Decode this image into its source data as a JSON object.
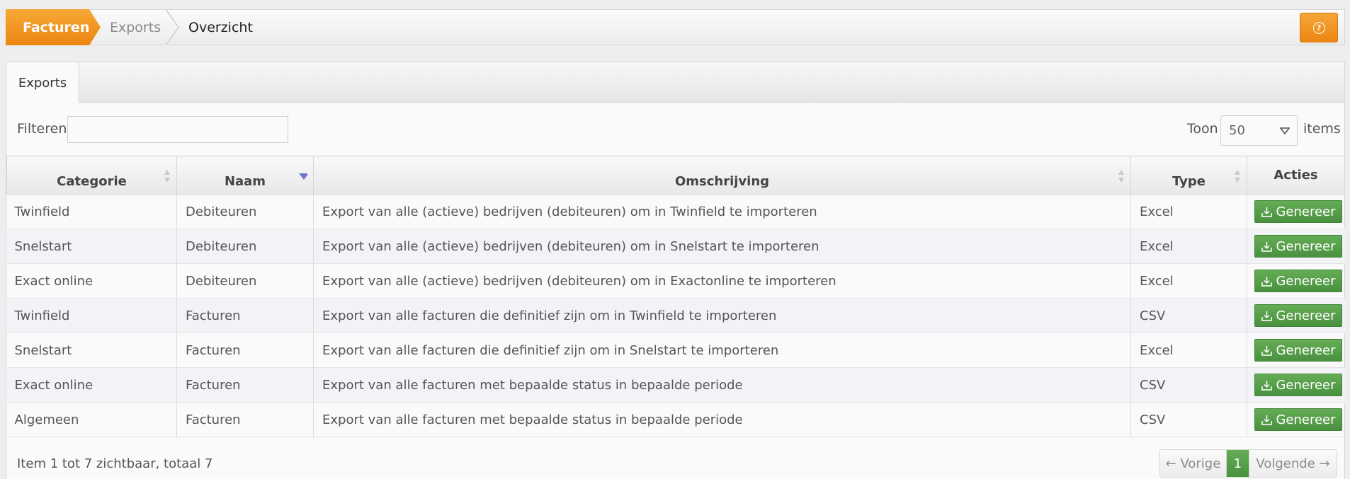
{
  "breadcrumb": {
    "home": "Facturen",
    "items": [
      "Exports",
      "Overzicht"
    ]
  },
  "help": {
    "icon": "help-icon",
    "glyph": "?"
  },
  "tabs": [
    {
      "label": "Exports"
    }
  ],
  "filter": {
    "label": "Filteren",
    "value": ""
  },
  "page_size": {
    "label_before": "Toon",
    "value": "50",
    "label_after": "items"
  },
  "table": {
    "columns": [
      "Categorie",
      "Naam",
      "Omschrijving",
      "Type",
      "Acties"
    ],
    "sorted_column": "Naam",
    "sort_direction": "descending",
    "action_label": "Genereer",
    "rows": [
      {
        "categorie": "Twinfield",
        "naam": "Debiteuren",
        "omschrijving": "Export van alle (actieve) bedrijven (debiteuren) om in Twinfield te importeren",
        "type": "Excel"
      },
      {
        "categorie": "Snelstart",
        "naam": "Debiteuren",
        "omschrijving": "Export van alle (actieve) bedrijven (debiteuren) om in Snelstart te importeren",
        "type": "Excel"
      },
      {
        "categorie": "Exact online",
        "naam": "Debiteuren",
        "omschrijving": "Export van alle (actieve) bedrijven (debiteuren) om in Exactonline te importeren",
        "type": "Excel"
      },
      {
        "categorie": "Twinfield",
        "naam": "Facturen",
        "omschrijving": "Export van alle facturen die definitief zijn om in Twinfield te importeren",
        "type": "CSV"
      },
      {
        "categorie": "Snelstart",
        "naam": "Facturen",
        "omschrijving": "Export van alle facturen die definitief zijn om in Snelstart te importeren",
        "type": "Excel"
      },
      {
        "categorie": "Exact online",
        "naam": "Facturen",
        "omschrijving": "Export van alle facturen met bepaalde status in bepaalde periode",
        "type": "CSV"
      },
      {
        "categorie": "Algemeen",
        "naam": "Facturen",
        "omschrijving": "Export van alle facturen met bepaalde status in bepaalde periode",
        "type": "CSV"
      }
    ]
  },
  "footer": {
    "info": "Item 1 tot 7 zichtbaar, totaal 7",
    "prev": "← Vorige",
    "page": "1",
    "next": "Volgende →"
  },
  "colors": {
    "accent_orange": "#ef8c1a",
    "action_green": "#56a049"
  }
}
